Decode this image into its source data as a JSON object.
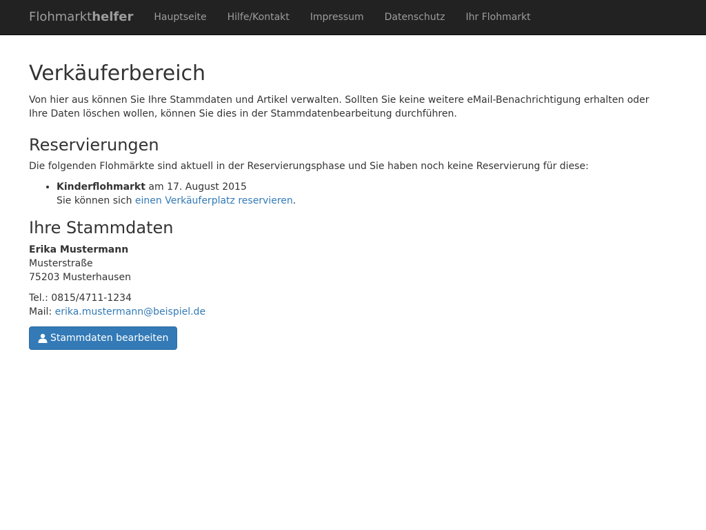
{
  "navbar": {
    "brand_regular": "Flohmarkt",
    "brand_bold": "helfer",
    "links": [
      "Hauptseite",
      "Hilfe/Kontakt",
      "Impressum",
      "Datenschutz",
      "Ihr Flohmarkt"
    ]
  },
  "main": {
    "title": "Verkäuferbereich",
    "intro": "Von hier aus können Sie Ihre Stammdaten und Artikel verwalten. Sollten Sie keine weitere eMail-Benachrichtigung erhalten oder Ihre Daten löschen wollen, können Sie dies in der Stammdatenbearbeitung durchführen."
  },
  "reservations": {
    "heading": "Reservierungen",
    "text": "Die folgenden Flohmärkte sind aktuell in der Reservierungsphase und Sie haben noch keine Reservierung für diese:",
    "items": [
      {
        "name": "Kinderflohmarkt",
        "date_text": " am 17. August 2015",
        "prefix": "Sie können sich ",
        "link": "einen Verkäuferplatz reservieren",
        "suffix": "."
      }
    ]
  },
  "master_data": {
    "heading": "Ihre Stammdaten",
    "name": "Erika Mustermann",
    "street": "Musterstraße",
    "city": "75203 Musterhausen",
    "phone_label": "Tel.: ",
    "phone": "0815/4711-1234",
    "mail_label": "Mail: ",
    "mail": "erika.mustermann@beispiel.de",
    "edit_button": "Stammdaten bearbeiten",
    "edit_icon": "user-icon"
  },
  "colors": {
    "navbar_bg": "#222222",
    "link": "#337ab7",
    "primary_button": "#337ab7"
  }
}
